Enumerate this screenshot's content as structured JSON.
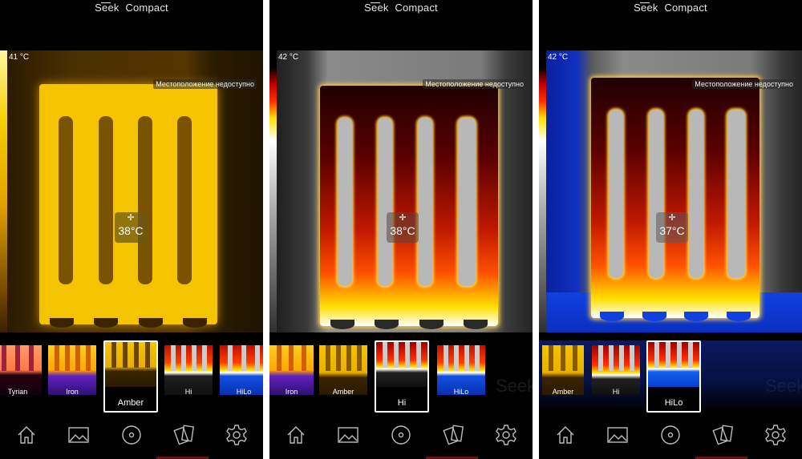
{
  "app": {
    "brand": "Seek",
    "product": "Compact",
    "location_status": "Местоположение недоступно",
    "watermark": "Seek"
  },
  "colors": {
    "background": "#000000",
    "amber_hot": "#f5c400",
    "amber_cold": "#3a2400",
    "hi_hot": "#ff2200",
    "hi_cold": "#3c3c3c",
    "hilo_cold": "#1030d0",
    "selected_border": "#ffffff",
    "nav_icon": "#bdbdbd"
  },
  "panels": [
    {
      "palette": "Amber",
      "max_temp": "41 °C",
      "spot_temp": "38°C",
      "thumbnails": [
        {
          "label": "Tyrian",
          "selected": false
        },
        {
          "label": "Iron",
          "selected": false
        },
        {
          "label": "Amber",
          "selected": true
        },
        {
          "label": "Hi",
          "selected": false
        },
        {
          "label": "HiLo",
          "selected": false
        }
      ]
    },
    {
      "palette": "Hi",
      "max_temp": "42 °C",
      "spot_temp": "38°C",
      "thumbnails": [
        {
          "label": "Iron",
          "selected": false
        },
        {
          "label": "Amber",
          "selected": false
        },
        {
          "label": "Hi",
          "selected": true
        },
        {
          "label": "HiLo",
          "selected": false
        }
      ]
    },
    {
      "palette": "HiLo",
      "max_temp": "42 °C",
      "spot_temp": "37°C",
      "thumbnails": [
        {
          "label": "Amber",
          "selected": false
        },
        {
          "label": "Hi",
          "selected": false
        },
        {
          "label": "HiLo",
          "selected": true
        }
      ]
    }
  ],
  "nav": {
    "items": [
      {
        "icon": "home-icon"
      },
      {
        "icon": "gallery-icon"
      },
      {
        "icon": "capture-icon"
      },
      {
        "icon": "palettes-icon",
        "active": true
      },
      {
        "icon": "settings-icon"
      }
    ]
  }
}
